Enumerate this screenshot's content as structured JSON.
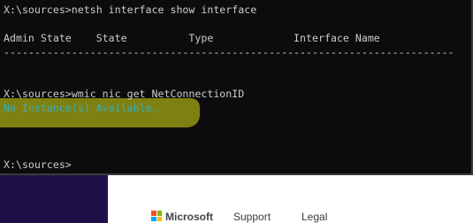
{
  "console": {
    "lines": [
      "X:\\sources>netsh interface show interface",
      "",
      "Admin State    State          Type             Interface Name",
      "-------------------------------------------------------------------------",
      "",
      "",
      "X:\\sources>wmic nic get NetConnectionID",
      "No Instance(s) Available.",
      "",
      "",
      "",
      "X:\\sources>"
    ]
  },
  "footer": {
    "brand": "Microsoft",
    "support": "Support",
    "legal": "Legal"
  },
  "colors": {
    "console_bg": "#0c0c0c",
    "console_text": "#cccccc",
    "highlight_text": "#34b0c4",
    "highlighter": "#999a13",
    "left_strip": "#20104a"
  }
}
